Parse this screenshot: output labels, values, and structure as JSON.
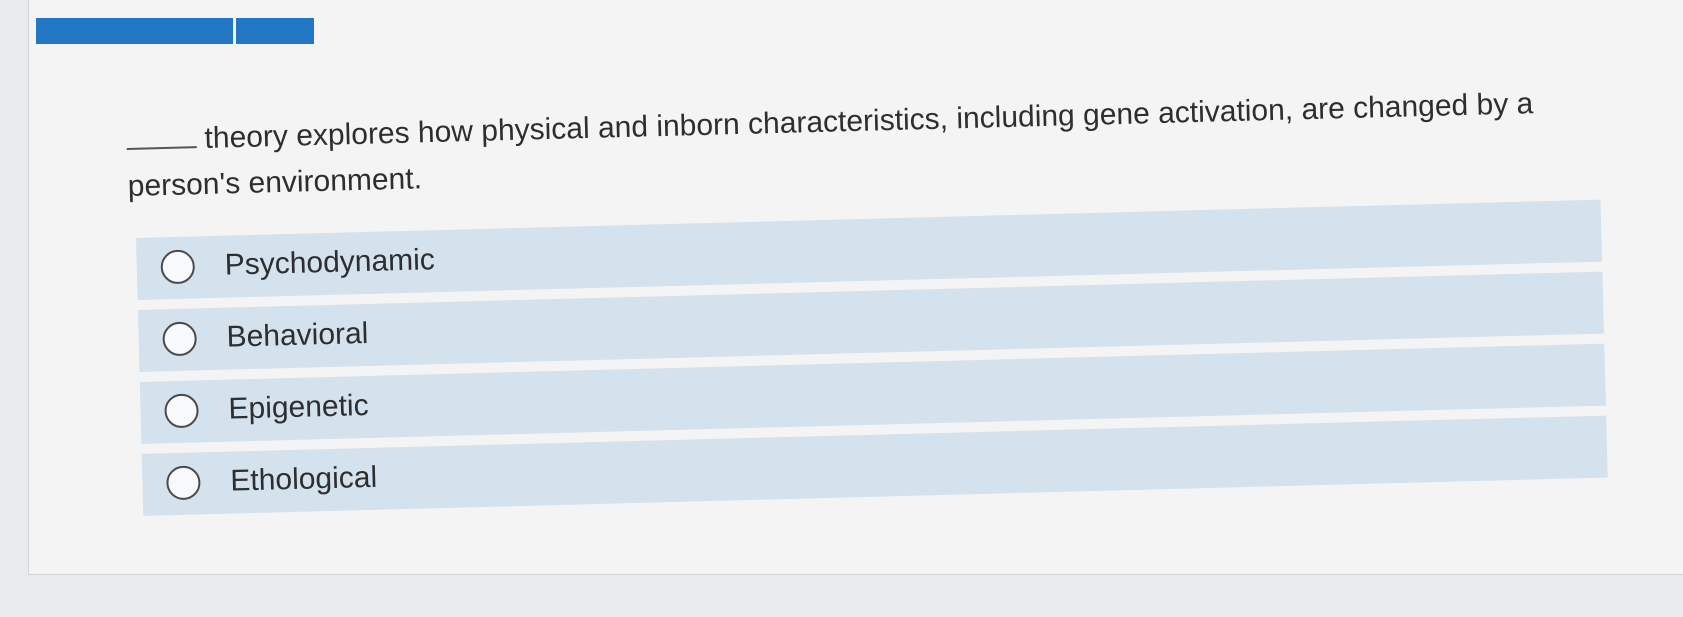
{
  "question": {
    "stem_text": "theory explores how physical and inborn characteristics, including gene activation, are changed by a person's environment."
  },
  "options": [
    {
      "label": "Psychodynamic"
    },
    {
      "label": "Behavioral"
    },
    {
      "label": "Epigenetic"
    },
    {
      "label": "Ethological"
    }
  ],
  "colors": {
    "accent": "#2277c5",
    "option_background": "#d4e2ed"
  },
  "icons": {
    "radio": "radio-button-icon"
  }
}
